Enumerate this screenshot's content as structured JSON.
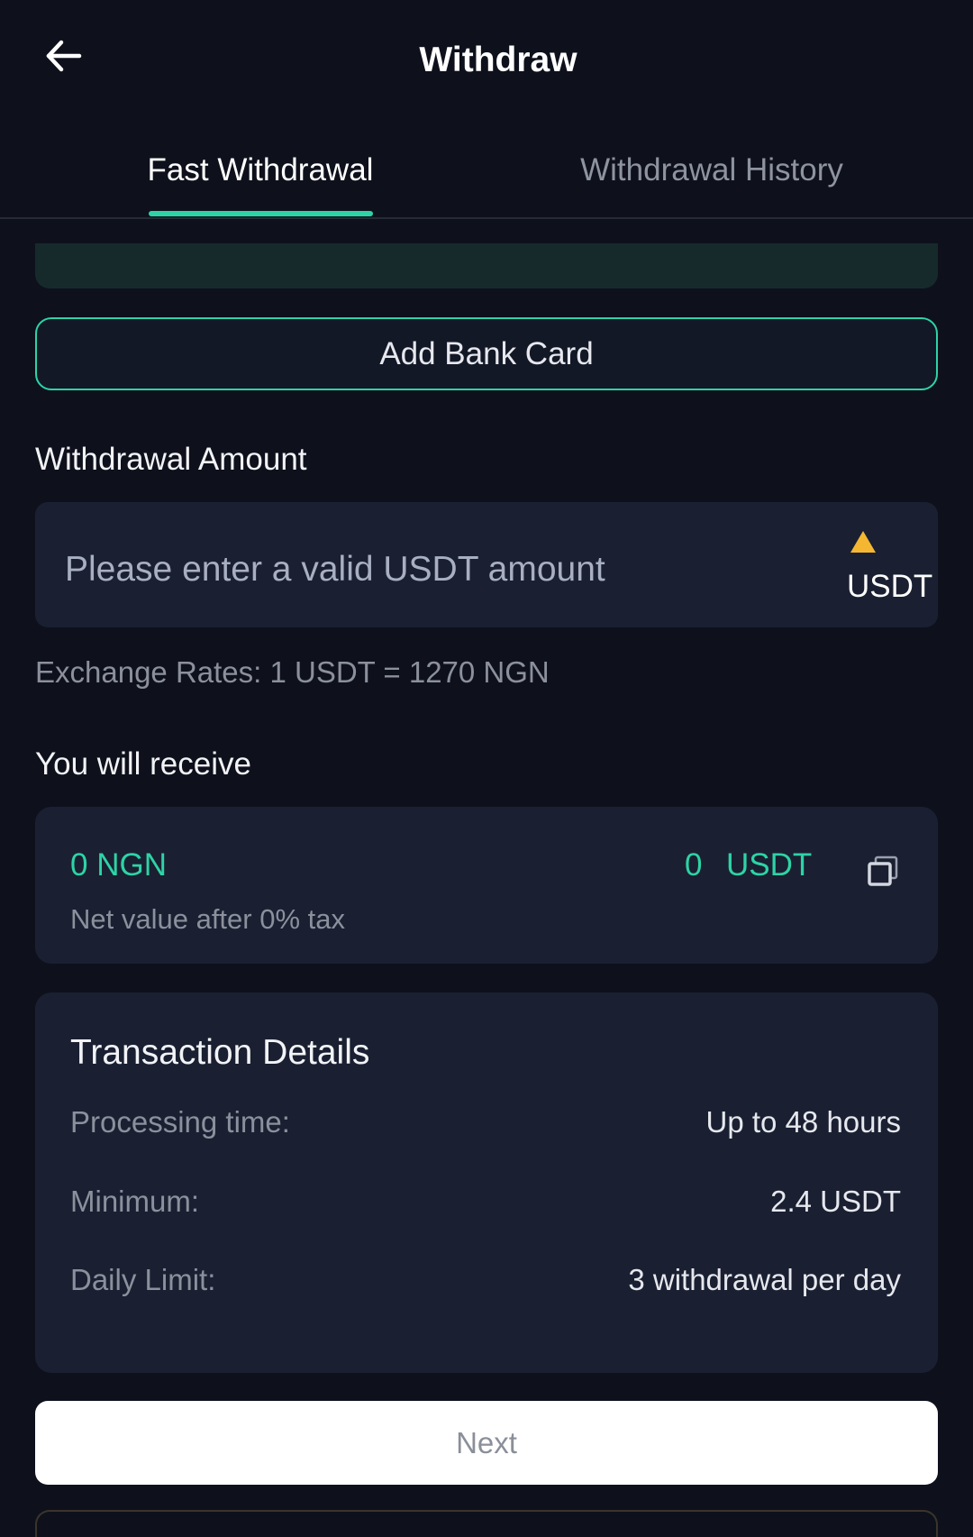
{
  "header": {
    "title": "Withdraw",
    "back_icon": "arrow-left-icon"
  },
  "tabs": [
    {
      "label": "Fast Withdrawal",
      "active": true
    },
    {
      "label": "Withdrawal History",
      "active": false
    }
  ],
  "add_bank_card": {
    "label": "Add Bank Card"
  },
  "amount": {
    "label": "Withdrawal Amount",
    "placeholder": "Please enter a valid USDT amount",
    "value": "",
    "currency": "USDT",
    "warning_icon": "warning-triangle-icon"
  },
  "exchange_rate": "Exchange Rates: 1 USDT = 1270 NGN",
  "receive": {
    "label": "You will receive",
    "ngn": "0 NGN",
    "usdt_value": "0",
    "usdt_unit": "USDT",
    "note": "Net value after 0% tax",
    "copy_icon": "copy-icon"
  },
  "details": {
    "title": "Transaction Details",
    "rows": [
      {
        "label": "Processing time:",
        "value": "Up to 48 hours"
      },
      {
        "label": "Minimum:",
        "value": "2.4 USDT"
      },
      {
        "label": "Daily Limit:",
        "value": "3 withdrawal per day"
      }
    ]
  },
  "next_button": {
    "label": "Next"
  },
  "colors": {
    "background": "#0E111C",
    "card": "#1A2032",
    "accent": "#2ED3A5",
    "warning": "#F5B731"
  }
}
